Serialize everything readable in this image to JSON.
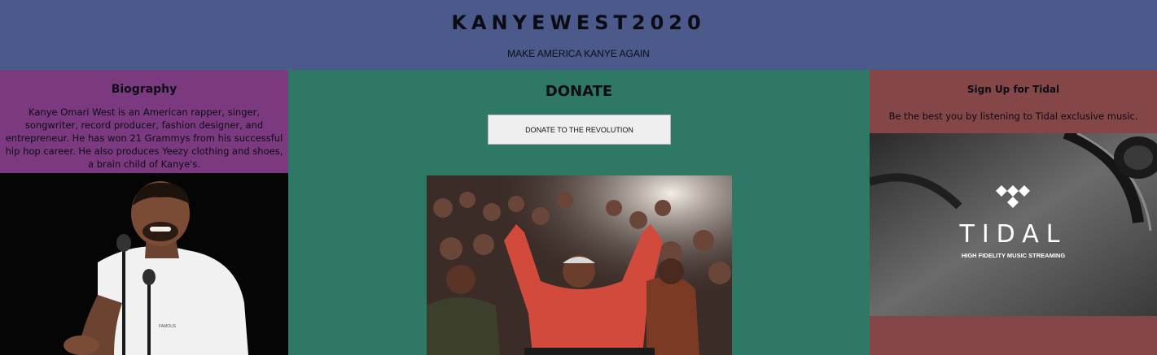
{
  "header": {
    "title": "KANYEWEST2020",
    "tagline": "MAKE AMERICA KANYE AGAIN"
  },
  "biography": {
    "heading": "Biography",
    "text": "Kanye Omari West is an American rapper, singer, songwriter, record producer, fashion designer, and entrepreneur. He has won 21 Grammys from his successful hip hop career. He also produces Yeezy clothing and shoes, a brain child of Kanye's."
  },
  "donate": {
    "heading": "DONATE",
    "button_label": "DONATE TO THE REVOLUTION"
  },
  "tidal": {
    "heading": "Sign Up for Tidal",
    "text": "Be the best you by listening to Tidal exclusive music.",
    "logo_word": "TIDAL",
    "logo_sub": "HIGH FIDELITY MUSIC STREAMING"
  },
  "colors": {
    "header_bg": "#4b5a8b",
    "bio_bg": "#7b3a7f",
    "donate_bg": "#2f7866",
    "tidal_bg": "#844647"
  }
}
